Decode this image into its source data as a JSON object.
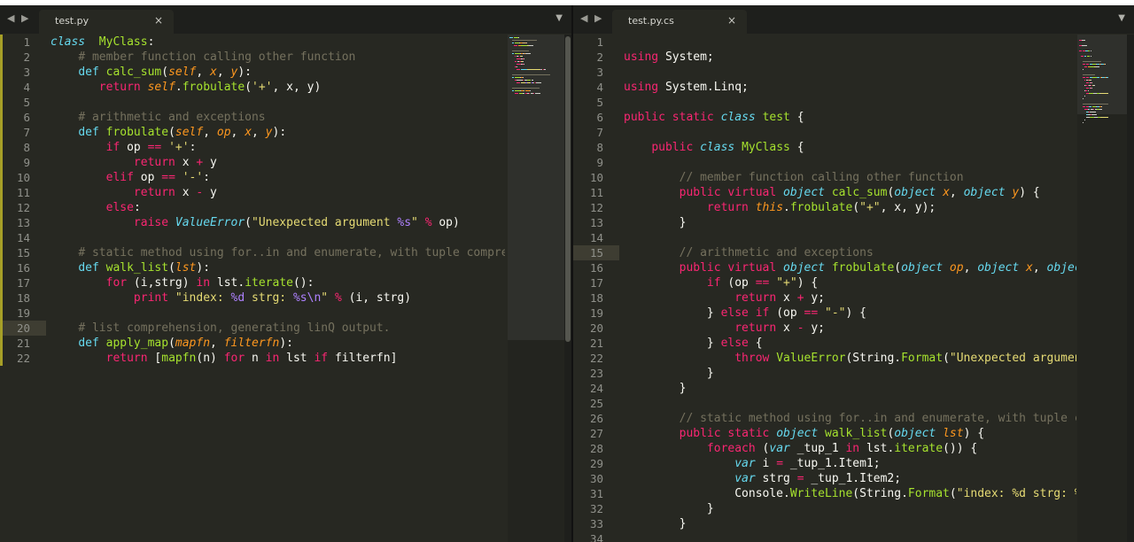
{
  "left_pane": {
    "tab_title": "test.py",
    "close_glyph": "×",
    "nav_glyph": "◀ ▶",
    "dropdown_glyph": "▼",
    "active_line": 20,
    "modified_lines": [
      1,
      2,
      3,
      4,
      5,
      6,
      7,
      8,
      9,
      10,
      11,
      12,
      13,
      14,
      15,
      16,
      17,
      18,
      19,
      20,
      21,
      22
    ],
    "lines": [
      [
        [
          "t",
          "class"
        ],
        [
          "",
          "  "
        ],
        [
          "f",
          "MyClass"
        ],
        [
          "",
          ":"
        ]
      ],
      [
        [
          "",
          "    "
        ],
        [
          "c",
          "# member function calling other function"
        ]
      ],
      [
        [
          "",
          "    "
        ],
        [
          "b",
          "def"
        ],
        [
          "",
          " "
        ],
        [
          "f",
          "calc_sum"
        ],
        [
          "",
          "("
        ],
        [
          "p",
          "self"
        ],
        [
          "",
          ", "
        ],
        [
          "p",
          "x"
        ],
        [
          "",
          ", "
        ],
        [
          "p",
          "y"
        ],
        [
          "",
          "):"
        ]
      ],
      [
        [
          "",
          "       "
        ],
        [
          "k",
          "return"
        ],
        [
          "",
          " "
        ],
        [
          "p",
          "self"
        ],
        [
          "",
          "."
        ],
        [
          "f",
          "frobulate"
        ],
        [
          "",
          "("
        ],
        [
          "s",
          "'+'"
        ],
        [
          "",
          ", x, y)"
        ]
      ],
      [
        [
          "",
          ""
        ]
      ],
      [
        [
          "",
          "    "
        ],
        [
          "c",
          "# arithmetic and exceptions"
        ]
      ],
      [
        [
          "",
          "    "
        ],
        [
          "b",
          "def"
        ],
        [
          "",
          " "
        ],
        [
          "f",
          "frobulate"
        ],
        [
          "",
          "("
        ],
        [
          "p",
          "self"
        ],
        [
          "",
          ", "
        ],
        [
          "p",
          "op"
        ],
        [
          "",
          ", "
        ],
        [
          "p",
          "x"
        ],
        [
          "",
          ", "
        ],
        [
          "p",
          "y"
        ],
        [
          "",
          "):"
        ]
      ],
      [
        [
          "",
          "        "
        ],
        [
          "k",
          "if"
        ],
        [
          "",
          " op "
        ],
        [
          "k",
          "=="
        ],
        [
          "",
          " "
        ],
        [
          "s",
          "'+'"
        ],
        [
          "",
          ":"
        ]
      ],
      [
        [
          "",
          "            "
        ],
        [
          "k",
          "return"
        ],
        [
          "",
          " x "
        ],
        [
          "k",
          "+"
        ],
        [
          "",
          " y"
        ]
      ],
      [
        [
          "",
          "        "
        ],
        [
          "k",
          "elif"
        ],
        [
          "",
          " op "
        ],
        [
          "k",
          "=="
        ],
        [
          "",
          " "
        ],
        [
          "s",
          "'-'"
        ],
        [
          "",
          ":"
        ]
      ],
      [
        [
          "",
          "            "
        ],
        [
          "k",
          "return"
        ],
        [
          "",
          " x "
        ],
        [
          "k",
          "-"
        ],
        [
          "",
          " y"
        ]
      ],
      [
        [
          "",
          "        "
        ],
        [
          "k",
          "else"
        ],
        [
          "",
          ":"
        ]
      ],
      [
        [
          "",
          "            "
        ],
        [
          "k",
          "raise"
        ],
        [
          "",
          " "
        ],
        [
          "t",
          "ValueError"
        ],
        [
          "",
          "("
        ],
        [
          "s",
          "\"Unexpected argument "
        ],
        [
          "n",
          "%s"
        ],
        [
          "s",
          "\""
        ],
        [
          "",
          " "
        ],
        [
          "k",
          "%"
        ],
        [
          "",
          " op)"
        ]
      ],
      [
        [
          "",
          ""
        ]
      ],
      [
        [
          "",
          "    "
        ],
        [
          "c",
          "# static method using for..in and enumerate, with tuple compre"
        ]
      ],
      [
        [
          "",
          "    "
        ],
        [
          "b",
          "def"
        ],
        [
          "",
          " "
        ],
        [
          "f",
          "walk_list"
        ],
        [
          "",
          "("
        ],
        [
          "p",
          "lst"
        ],
        [
          "",
          "):"
        ]
      ],
      [
        [
          "",
          "        "
        ],
        [
          "k",
          "for"
        ],
        [
          "",
          " (i,strg) "
        ],
        [
          "k",
          "in"
        ],
        [
          "",
          " lst."
        ],
        [
          "f",
          "iterate"
        ],
        [
          "",
          "():"
        ]
      ],
      [
        [
          "",
          "            "
        ],
        [
          "k",
          "print"
        ],
        [
          "",
          " "
        ],
        [
          "s",
          "\"index: "
        ],
        [
          "n",
          "%d"
        ],
        [
          "s",
          " strg: "
        ],
        [
          "n",
          "%s\\n"
        ],
        [
          "s",
          "\""
        ],
        [
          "",
          " "
        ],
        [
          "k",
          "%"
        ],
        [
          "",
          " (i, strg)"
        ]
      ],
      [
        [
          "",
          ""
        ]
      ],
      [
        [
          "",
          "    "
        ],
        [
          "c",
          "# list comprehension, generating linQ output."
        ]
      ],
      [
        [
          "",
          "    "
        ],
        [
          "b",
          "def"
        ],
        [
          "",
          " "
        ],
        [
          "f",
          "apply_map"
        ],
        [
          "",
          "("
        ],
        [
          "p",
          "mapfn"
        ],
        [
          "",
          ", "
        ],
        [
          "p",
          "filterfn"
        ],
        [
          "",
          "):"
        ]
      ],
      [
        [
          "",
          "        "
        ],
        [
          "k",
          "return"
        ],
        [
          "",
          " ["
        ],
        [
          "f",
          "mapfn"
        ],
        [
          "",
          "(n) "
        ],
        [
          "k",
          "for"
        ],
        [
          "",
          " n "
        ],
        [
          "k",
          "in"
        ],
        [
          "",
          " lst "
        ],
        [
          "k",
          "if"
        ],
        [
          "",
          " filterfn]"
        ]
      ]
    ]
  },
  "right_pane": {
    "tab_title": "test.py.cs",
    "close_glyph": "×",
    "dropdown_glyph": "▼",
    "active_line": 15,
    "lines": [
      [
        [
          "",
          ""
        ]
      ],
      [
        [
          "k",
          "using"
        ],
        [
          "",
          " System;"
        ]
      ],
      [
        [
          "",
          ""
        ]
      ],
      [
        [
          "k",
          "using"
        ],
        [
          "",
          " System.Linq;"
        ]
      ],
      [
        [
          "",
          ""
        ]
      ],
      [
        [
          "k",
          "public"
        ],
        [
          "",
          " "
        ],
        [
          "k",
          "static"
        ],
        [
          "",
          " "
        ],
        [
          "kw2",
          "class"
        ],
        [
          "",
          " "
        ],
        [
          "f",
          "test"
        ],
        [
          "",
          " {"
        ]
      ],
      [
        [
          "",
          ""
        ]
      ],
      [
        [
          "",
          "    "
        ],
        [
          "k",
          "public"
        ],
        [
          "",
          " "
        ],
        [
          "kw2",
          "class"
        ],
        [
          "",
          " "
        ],
        [
          "f",
          "MyClass"
        ],
        [
          "",
          " {"
        ]
      ],
      [
        [
          "",
          ""
        ]
      ],
      [
        [
          "",
          "        "
        ],
        [
          "c",
          "// member function calling other function"
        ]
      ],
      [
        [
          "",
          "        "
        ],
        [
          "k",
          "public"
        ],
        [
          "",
          " "
        ],
        [
          "k",
          "virtual"
        ],
        [
          "",
          " "
        ],
        [
          "kw2",
          "object"
        ],
        [
          "",
          " "
        ],
        [
          "f",
          "calc_sum"
        ],
        [
          "",
          "("
        ],
        [
          "kw2",
          "object"
        ],
        [
          "",
          " "
        ],
        [
          "p",
          "x"
        ],
        [
          "",
          ", "
        ],
        [
          "kw2",
          "object"
        ],
        [
          "",
          " "
        ],
        [
          "p",
          "y"
        ],
        [
          "",
          ") {"
        ]
      ],
      [
        [
          "",
          "            "
        ],
        [
          "k",
          "return"
        ],
        [
          "",
          " "
        ],
        [
          "p",
          "this"
        ],
        [
          "",
          "."
        ],
        [
          "f",
          "frobulate"
        ],
        [
          "",
          "("
        ],
        [
          "s",
          "\"+\""
        ],
        [
          "",
          ", x, y);"
        ]
      ],
      [
        [
          "",
          "        }"
        ]
      ],
      [
        [
          "",
          ""
        ]
      ],
      [
        [
          "",
          "        "
        ],
        [
          "c",
          "// arithmetic and exceptions"
        ]
      ],
      [
        [
          "",
          "        "
        ],
        [
          "k",
          "public"
        ],
        [
          "",
          " "
        ],
        [
          "k",
          "virtual"
        ],
        [
          "",
          " "
        ],
        [
          "kw2",
          "object"
        ],
        [
          "",
          " "
        ],
        [
          "f",
          "frobulate"
        ],
        [
          "",
          "("
        ],
        [
          "kw2",
          "object"
        ],
        [
          "",
          " "
        ],
        [
          "p",
          "op"
        ],
        [
          "",
          ", "
        ],
        [
          "kw2",
          "object"
        ],
        [
          "",
          " "
        ],
        [
          "p",
          "x"
        ],
        [
          "",
          ", "
        ],
        [
          "kw2",
          "objec"
        ]
      ],
      [
        [
          "",
          "            "
        ],
        [
          "k",
          "if"
        ],
        [
          "",
          " (op "
        ],
        [
          "k",
          "=="
        ],
        [
          "",
          " "
        ],
        [
          "s",
          "\"+\""
        ],
        [
          "",
          ") {"
        ]
      ],
      [
        [
          "",
          "                "
        ],
        [
          "k",
          "return"
        ],
        [
          "",
          " x "
        ],
        [
          "k",
          "+"
        ],
        [
          "",
          " y;"
        ]
      ],
      [
        [
          "",
          "            } "
        ],
        [
          "k",
          "else"
        ],
        [
          "",
          " "
        ],
        [
          "k",
          "if"
        ],
        [
          "",
          " (op "
        ],
        [
          "k",
          "=="
        ],
        [
          "",
          " "
        ],
        [
          "s",
          "\"-\""
        ],
        [
          "",
          ") {"
        ]
      ],
      [
        [
          "",
          "                "
        ],
        [
          "k",
          "return"
        ],
        [
          "",
          " x "
        ],
        [
          "k",
          "-"
        ],
        [
          "",
          " y;"
        ]
      ],
      [
        [
          "",
          "            } "
        ],
        [
          "k",
          "else"
        ],
        [
          "",
          " {"
        ]
      ],
      [
        [
          "",
          "                "
        ],
        [
          "k",
          "throw"
        ],
        [
          "",
          " "
        ],
        [
          "f",
          "ValueError"
        ],
        [
          "",
          "(String."
        ],
        [
          "f",
          "Format"
        ],
        [
          "",
          "("
        ],
        [
          "s",
          "\"Unexpected argumen"
        ]
      ],
      [
        [
          "",
          "            }"
        ]
      ],
      [
        [
          "",
          "        }"
        ]
      ],
      [
        [
          "",
          ""
        ]
      ],
      [
        [
          "",
          "        "
        ],
        [
          "c",
          "// static method using for..in and enumerate, with tuple c"
        ]
      ],
      [
        [
          "",
          "        "
        ],
        [
          "k",
          "public"
        ],
        [
          "",
          " "
        ],
        [
          "k",
          "static"
        ],
        [
          "",
          " "
        ],
        [
          "kw2",
          "object"
        ],
        [
          "",
          " "
        ],
        [
          "f",
          "walk_list"
        ],
        [
          "",
          "("
        ],
        [
          "kw2",
          "object"
        ],
        [
          "",
          " "
        ],
        [
          "p",
          "lst"
        ],
        [
          "",
          ") {"
        ]
      ],
      [
        [
          "",
          "            "
        ],
        [
          "k",
          "foreach"
        ],
        [
          "",
          " ("
        ],
        [
          "kw2",
          "var"
        ],
        [
          "",
          " _tup_1 "
        ],
        [
          "k",
          "in"
        ],
        [
          "",
          " lst."
        ],
        [
          "f",
          "iterate"
        ],
        [
          "",
          "()) {"
        ]
      ],
      [
        [
          "",
          "                "
        ],
        [
          "kw2",
          "var"
        ],
        [
          "",
          " i "
        ],
        [
          "k",
          "="
        ],
        [
          "",
          " _tup_1.Item1;"
        ]
      ],
      [
        [
          "",
          "                "
        ],
        [
          "kw2",
          "var"
        ],
        [
          "",
          " strg "
        ],
        [
          "k",
          "="
        ],
        [
          "",
          " _tup_1.Item2;"
        ]
      ],
      [
        [
          "",
          "                Console."
        ],
        [
          "f",
          "WriteLine"
        ],
        [
          "",
          "(String."
        ],
        [
          "f",
          "Format"
        ],
        [
          "",
          "("
        ],
        [
          "s",
          "\"index: %d strg: %"
        ]
      ],
      [
        [
          "",
          "            }"
        ]
      ],
      [
        [
          "",
          "        }"
        ]
      ],
      [
        [
          "",
          ""
        ]
      ]
    ]
  }
}
